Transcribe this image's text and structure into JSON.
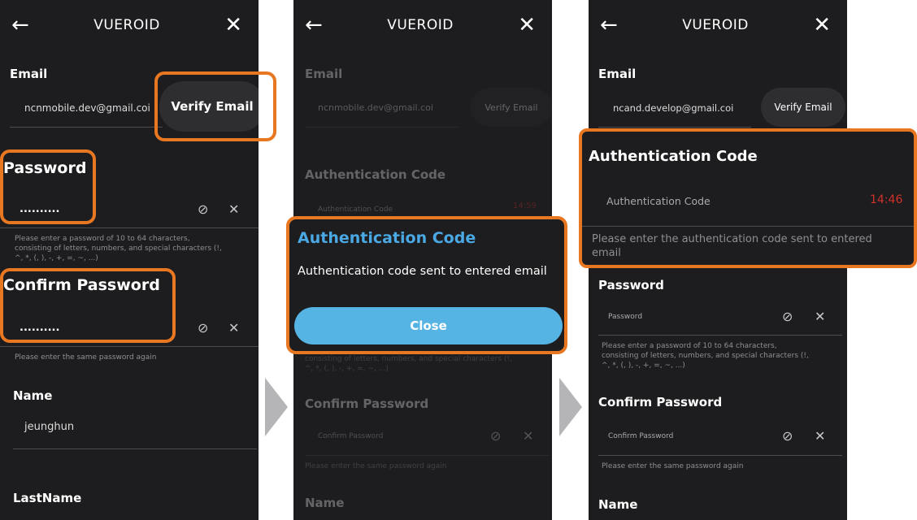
{
  "app": {
    "title": "VUEROID"
  },
  "screen1": {
    "email_label": "Email",
    "email_value": "ncnmobile.dev@gmail.coi",
    "verify_label": "Verify Email",
    "password_label": "Password",
    "password_value": "..........",
    "password_help_1": "Please enter a password of 10 to 64 characters,",
    "password_help_2": "consisting of letters, numbers, and special characters (!,",
    "password_help_3": "^, *, (, ), -, +, =, ~, ...)",
    "confirm_label": "Confirm Password",
    "confirm_value": "..........",
    "confirm_help": "Please enter the same password again",
    "name_label": "Name",
    "name_value": "jeunghun",
    "lastname_label": "LastName"
  },
  "screen2": {
    "email_label": "Email",
    "email_value": "ncnmobile.dev@gmail.coi",
    "verify_label": "Verify Email",
    "auth_label": "Authentication Code",
    "auth_placeholder": "Authentication Code",
    "timer": "14:59",
    "help_partial_1": "consisting of letters, numbers, and special characters (!,",
    "help_partial_2": "^, *, (, ), -, +, =, ~, ...)",
    "confirm_label": "Confirm Password",
    "confirm_placeholder": "Confirm Password",
    "confirm_help": "Please enter the same password again",
    "name_label": "Name",
    "modal": {
      "title": "Authentication Code",
      "message": "Authentication code sent to entered email",
      "close_label": "Close"
    }
  },
  "screen3": {
    "email_label": "Email",
    "email_value": "ncand.develop@gmail.coi",
    "verify_label": "Verify Email",
    "auth_label": "Authentication Code",
    "auth_placeholder": "Authentication Code",
    "timer": "14:46",
    "auth_help_1": "Please enter the authentication code sent to entered",
    "auth_help_2": "email",
    "password_label": "Password",
    "password_placeholder": "Password",
    "password_help_1": "Please enter a password of 10 to 64 characters,",
    "password_help_2": "consisting of letters, numbers, and special characters (!,",
    "password_help_3": "^, *, (, ), -, +, =, ~, ...)",
    "confirm_label": "Confirm Password",
    "confirm_placeholder": "Confirm Password",
    "confirm_help": "Please enter the same password again",
    "name_label": "Name"
  },
  "colors": {
    "highlight": "#e87722",
    "accent": "#4aa8e4",
    "timer": "#d2302a",
    "background": "#1d1d1f"
  },
  "icons": {
    "back": "arrow-left-icon",
    "close": "x-icon",
    "eye": "eye-off-icon",
    "clear": "x-icon"
  }
}
